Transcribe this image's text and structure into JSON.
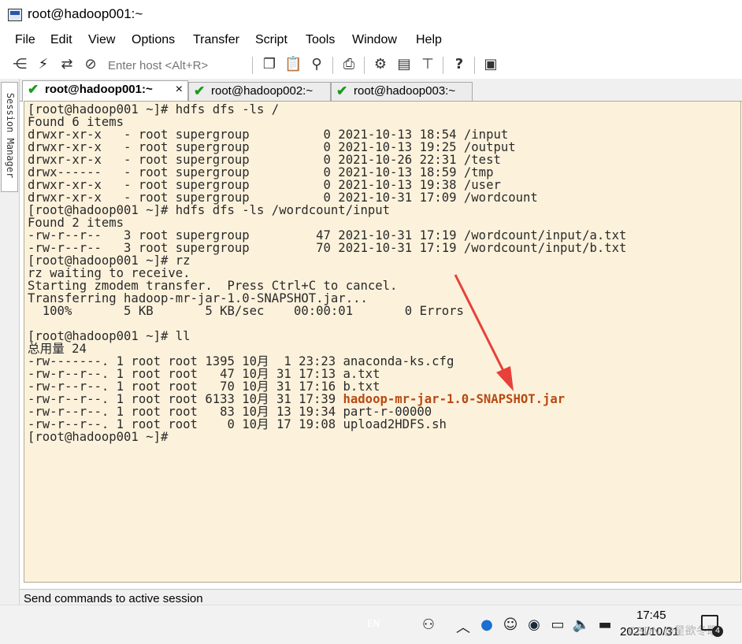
{
  "window": {
    "title": "root@hadoop001:~"
  },
  "menu": [
    "File",
    "Edit",
    "View",
    "Options",
    "Transfer",
    "Script",
    "Tools",
    "Window",
    "Help"
  ],
  "toolbar": {
    "host_placeholder": "Enter host <Alt+R>",
    "icons": [
      "connect-icon",
      "quick-connect-icon",
      "reconnect-icon",
      "disconnect-icon",
      "copy-icon",
      "paste-icon",
      "find-icon",
      "print-icon",
      "settings-icon",
      "keymap-icon",
      "sftp-icon",
      "help-icon",
      "screen-icon"
    ]
  },
  "session_manager": {
    "label": "Session Manager"
  },
  "tabs": [
    {
      "label": "root@hadoop001:~",
      "status": "connected",
      "active": true,
      "close": "×"
    },
    {
      "label": "root@hadoop002:~",
      "status": "connected",
      "active": false
    },
    {
      "label": "root@hadoop003:~",
      "status": "connected",
      "active": false
    }
  ],
  "terminal": {
    "lines": [
      "[root@hadoop001 ~]# hdfs dfs -ls /",
      "Found 6 items",
      "drwxr-xr-x   - root supergroup          0 2021-10-13 18:54 /input",
      "drwxr-xr-x   - root supergroup          0 2021-10-13 19:25 /output",
      "drwxr-xr-x   - root supergroup          0 2021-10-26 22:31 /test",
      "drwx------   - root supergroup          0 2021-10-13 18:59 /tmp",
      "drwxr-xr-x   - root supergroup          0 2021-10-13 19:38 /user",
      "drwxr-xr-x   - root supergroup          0 2021-10-31 17:09 /wordcount",
      "[root@hadoop001 ~]# hdfs dfs -ls /wordcount/input",
      "Found 2 items",
      "-rw-r--r--   3 root supergroup         47 2021-10-31 17:19 /wordcount/input/a.txt",
      "-rw-r--r--   3 root supergroup         70 2021-10-31 17:19 /wordcount/input/b.txt",
      "[root@hadoop001 ~]# rz",
      "rz waiting to receive.",
      "Starting zmodem transfer.  Press Ctrl+C to cancel.",
      "Transferring hadoop-mr-jar-1.0-SNAPSHOT.jar...",
      "  100%       5 KB       5 KB/sec    00:00:01       0 Errors",
      "",
      "[root@hadoop001 ~]# ll",
      "总用量 24",
      "-rw-------. 1 root root 1395 10月  1 23:23 anaconda-ks.cfg",
      "-rw-r--r--. 1 root root   47 10月 31 17:13 a.txt",
      "-rw-r--r--. 1 root root   70 10月 31 17:16 b.txt",
      "-rw-r--r--. 1 root root 6133 10月 31 17:39 ",
      "-rw-r--r--. 1 root root   83 10月 13 19:34 part-r-00000",
      "-rw-r--r--. 1 root root    0 10月 17 19:08 upload2HDFS.sh",
      "[root@hadoop001 ~]#"
    ],
    "highlighted_file": "hadoop-mr-jar-1.0-SNAPSHOT.jar",
    "highlight_color": "#b84a12",
    "background": "#fcf2dc"
  },
  "status_bar": {
    "text": "Send commands to active session"
  },
  "taskbar": {
    "lang": "EN",
    "time": "17:45",
    "date": "2021/10/31",
    "watermark": "CSDN @星欲冬眠",
    "notification_count": "4",
    "tray_icons": [
      "people-icon",
      "chevron-up-icon",
      "bluetooth-icon",
      "qq-icon",
      "steam-icon",
      "network-icon",
      "volume-icon",
      "battery-icon"
    ]
  }
}
